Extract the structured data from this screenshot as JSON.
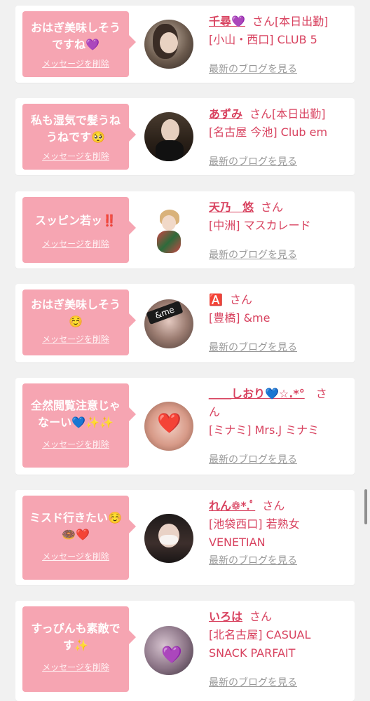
{
  "messages": [
    {
      "message": "おはぎ美味しそう\nですね💜",
      "delete_label": "メッセージを削除",
      "name": "千尋💜",
      "suffix": "さん[本日出勤]",
      "place": "[小山・西口] CLUB 5",
      "blog_label": "最新のブログを見る"
    },
    {
      "message": "私も湿気で髪うね\nうねです🥺",
      "delete_label": "メッセージを削除",
      "name": "あずみ",
      "suffix": "さん[本日出勤]",
      "place": "[名古屋 今池] Club em",
      "blog_label": "最新のブログを見る"
    },
    {
      "message": "スッピン若ッ‼️",
      "delete_label": "メッセージを削除",
      "name": "天乃　悠",
      "suffix": "さん",
      "place": "[中洲] マスカレード",
      "blog_label": "最新のブログを見る"
    },
    {
      "message": "おはぎ美味しそう\n☺️",
      "delete_label": "メッセージを削除",
      "name": "🅰️",
      "suffix": "さん",
      "place": "[豊橋] &me",
      "blog_label": "最新のブログを見る"
    },
    {
      "message": "全然閲覧注意じゃ\nなーい💙✨✨",
      "delete_label": "メッセージを削除",
      "name": "＿＿しおり💙☆.*°",
      "suffix": "さ",
      "suffix2": "ん",
      "place": "[ミナミ] Mrs.J ミナミ",
      "blog_label": "最新のブログを見る"
    },
    {
      "message": "ミスド行きたい☺️\n🍩❤️",
      "delete_label": "メッセージを削除",
      "name": "れん❁*.ﾟ",
      "suffix": "さん",
      "place": "[池袋西口] 若熟女\nVENETIAN",
      "blog_label": "最新のブログを見る"
    },
    {
      "message": "すっぴんも素敵で\nす✨",
      "delete_label": "メッセージを削除",
      "name": "いろは",
      "suffix": "さん",
      "place": "[北名古屋] CASUAL\nSNACK PARFAIT",
      "blog_label": "最新のブログを見る"
    }
  ],
  "avatar_overlays": {
    "card4_badge": "&me",
    "card5_heart": "❤️",
    "card7_heart": "💜"
  },
  "colors": {
    "bubble": "#f6a5b2",
    "name": "#d8425f",
    "blog_link": "#999999",
    "background": "#f1f1f1"
  }
}
